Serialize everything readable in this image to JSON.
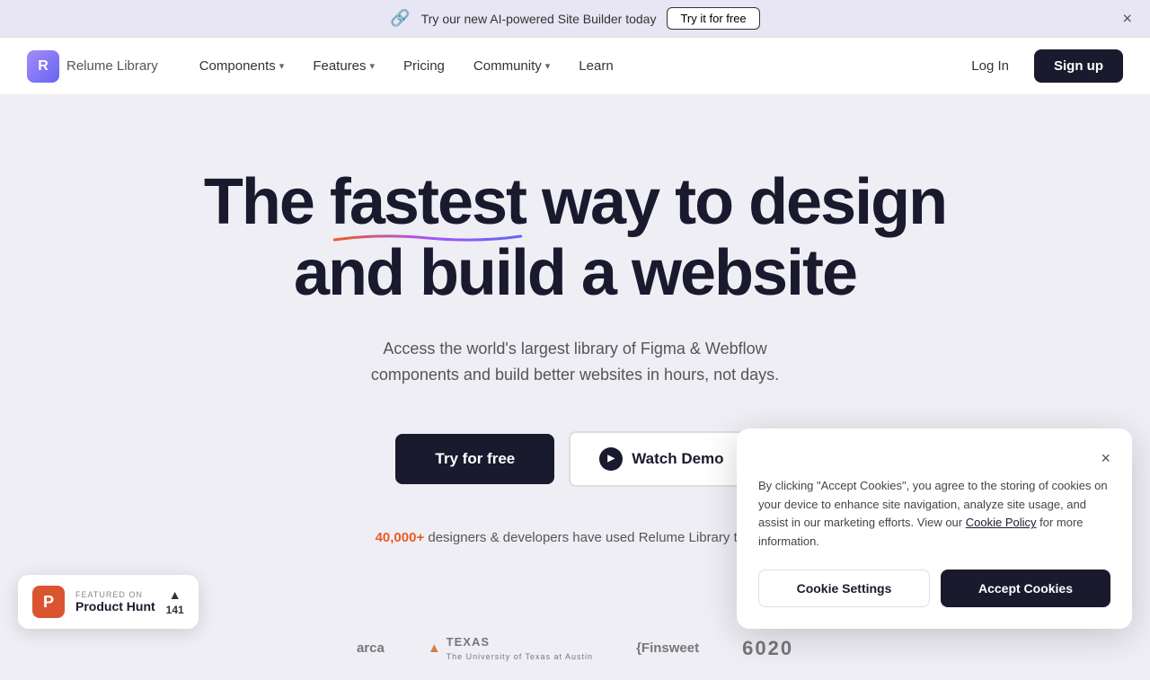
{
  "banner": {
    "icon": "🔗",
    "text": "Try our new AI-powered Site Builder today",
    "cta": "Try it for free",
    "close_label": "×"
  },
  "navbar": {
    "logo_text": "Relume",
    "logo_sub": "Library",
    "nav_items": [
      {
        "label": "Components",
        "has_dropdown": true
      },
      {
        "label": "Features",
        "has_dropdown": true
      },
      {
        "label": "Pricing",
        "has_dropdown": false
      },
      {
        "label": "Community",
        "has_dropdown": true
      },
      {
        "label": "Learn",
        "has_dropdown": false
      }
    ],
    "login_label": "Log In",
    "signup_label": "Sign up"
  },
  "hero": {
    "title_line1": "The fastest way to design",
    "title_line2": "and build a website",
    "underline_word": "fastest",
    "subtitle": "Access the world's largest library of Figma & Webflow\ncomponents and build better websites in hours, not days.",
    "cta_primary": "Try for free",
    "cta_demo": "Watch Demo",
    "social_proof_number": "40,000+",
    "social_proof_text": " designers & developers have used Relume Library to bu..."
  },
  "logos": [
    {
      "name": "Relume arca",
      "display": "arca"
    },
    {
      "name": "Texas",
      "display": "🔺 TEXAS"
    },
    {
      "name": "Finsweet",
      "display": "{Finsweet"
    },
    {
      "name": "6020",
      "display": "6020"
    }
  ],
  "product_hunt": {
    "featured_label": "FEATURED ON",
    "title": "Product Hunt",
    "votes": "141",
    "arrow": "▲"
  },
  "cookie_banner": {
    "text": "By clicking \"Accept Cookies\", you agree to the storing of cookies on your device to enhance site navigation, analyze site usage, and assist in our marketing efforts. View our Cookie Policy for more information.",
    "cookie_policy_label": "Cookie Policy",
    "settings_label": "Cookie Settings",
    "accept_label": "Accept Cookies",
    "close_label": "×"
  }
}
